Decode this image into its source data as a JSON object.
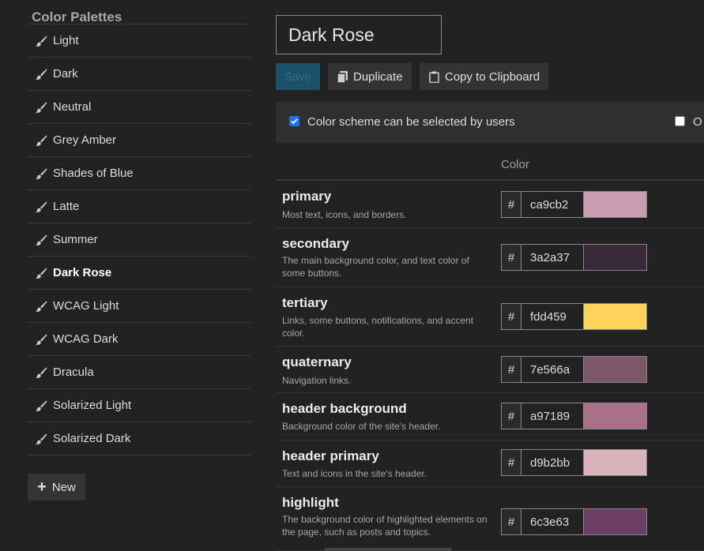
{
  "sidebar": {
    "title": "Color Palettes",
    "items": [
      {
        "label": "Light",
        "active": false
      },
      {
        "label": "Dark",
        "active": false
      },
      {
        "label": "Neutral",
        "active": false
      },
      {
        "label": "Grey Amber",
        "active": false
      },
      {
        "label": "Shades of Blue",
        "active": false
      },
      {
        "label": "Latte",
        "active": false
      },
      {
        "label": "Summer",
        "active": false
      },
      {
        "label": "Dark Rose",
        "active": true
      },
      {
        "label": "WCAG Light",
        "active": false
      },
      {
        "label": "WCAG Dark",
        "active": false
      },
      {
        "label": "Dracula",
        "active": false
      },
      {
        "label": "Solarized Light",
        "active": false
      },
      {
        "label": "Solarized Dark",
        "active": false
      }
    ],
    "new_label": "New"
  },
  "editor": {
    "name_value": "Dark Rose",
    "save_label": "Save",
    "duplicate_label": "Duplicate",
    "copy_label": "Copy to Clipboard",
    "user_selectable_label": "Color scheme can be selected by users",
    "user_selectable_checked": true,
    "second_option_label": "O",
    "second_option_checked": false,
    "color_column_header": "Color"
  },
  "colors": [
    {
      "name": "primary",
      "desc": "Most text, icons, and borders.",
      "hex": "ca9cb2",
      "swatch": "#ca9cb2"
    },
    {
      "name": "secondary",
      "desc": "The main background color, and text color of some buttons.",
      "hex": "3a2a37",
      "swatch": "#3a2a37"
    },
    {
      "name": "tertiary",
      "desc": "Links, some buttons, notifications, and accent color.",
      "hex": "fdd459",
      "swatch": "#fdd459"
    },
    {
      "name": "quaternary",
      "desc": "Navigation links.",
      "hex": "7e566a",
      "swatch": "#7e566a"
    },
    {
      "name": "header background",
      "desc": "Background color of the site's header.",
      "hex": "a97189",
      "swatch": "#a97189"
    },
    {
      "name": "header primary",
      "desc": "Text and icons in the site's header.",
      "hex": "d9b2bb",
      "swatch": "#d9b2bb"
    },
    {
      "name": "highlight",
      "desc": "The background color of highlighted elements on the page, such as posts and topics.",
      "hex": "6c3e63",
      "swatch": "#6c3e63"
    }
  ]
}
